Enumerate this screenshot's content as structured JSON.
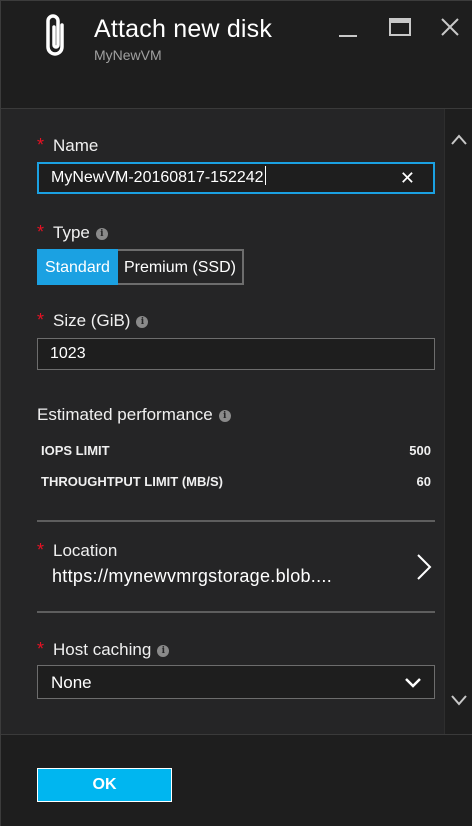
{
  "header": {
    "title": "Attach new disk",
    "subtitle": "MyNewVM",
    "icon": "paperclip-icon"
  },
  "window_controls": [
    "minimize-icon",
    "maximize-icon",
    "close-icon"
  ],
  "form": {
    "required_marker": "*",
    "info_glyph": "i",
    "name": {
      "label": "Name",
      "value": "MyNewVM-20160817-152242",
      "clear_glyph": "✕"
    },
    "type": {
      "label": "Type",
      "options": [
        "Standard",
        "Premium (SSD)"
      ],
      "selected": "Standard"
    },
    "size": {
      "label": "Size (GiB)",
      "value": "1023"
    },
    "performance": {
      "label": "Estimated performance",
      "rows": [
        {
          "name": "IOPS LIMIT",
          "value": "500"
        },
        {
          "name": "THROUGHTPUT LIMIT (MB/S)",
          "value": "60"
        }
      ]
    },
    "location": {
      "label": "Location",
      "value": "https://mynewvmrgstorage.blob...."
    },
    "host_caching": {
      "label": "Host caching",
      "value": "None"
    }
  },
  "footer": {
    "ok_label": "OK"
  },
  "colors": {
    "accent": "#1ba1e2",
    "ok_button": "#00b6f0",
    "required": "#e81123",
    "background": "#252526"
  }
}
